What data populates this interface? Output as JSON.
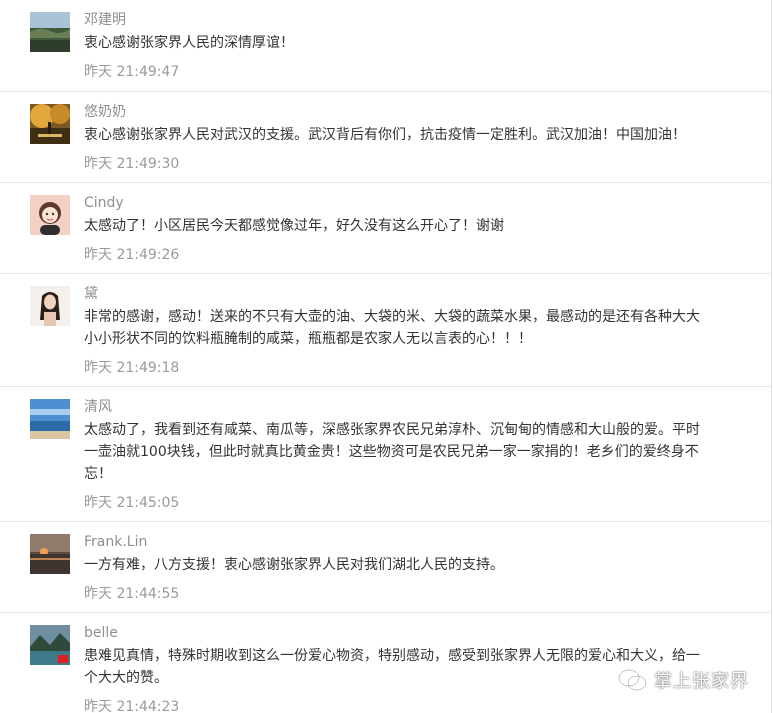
{
  "comments": [
    {
      "nickname": "邓建明",
      "avatar": "landscape-avatar",
      "content": "衷心感谢张家界人民的深情厚谊！",
      "time": "昨天 21:49:47"
    },
    {
      "nickname": "悠奶奶",
      "avatar": "autumn-trees-avatar",
      "content": "衷心感谢张家界人民对武汉的支援。武汉背后有你们，抗击疫情一定胜利。武汉加油！中国加油！",
      "time": "昨天 21:49:30"
    },
    {
      "nickname": "Cindy",
      "avatar": "cartoon-girl-avatar",
      "content": "太感动了！小区居民今天都感觉像过年，好久没有这么开心了！谢谢",
      "time": "昨天 21:49:26"
    },
    {
      "nickname": "黛",
      "avatar": "woman-portrait-avatar",
      "content": "非常的感谢，感动！送来的不只有大壶的油、大袋的米、大袋的蔬菜水果，最感动的是还有各种大大小小形状不同的饮料瓶腌制的咸菜，瓶瓶都是农家人无以言表的心！！！",
      "time": "昨天 21:49:18"
    },
    {
      "nickname": "清风",
      "avatar": "seascape-avatar",
      "content": "太感动了，我看到还有咸菜、南瓜等，深感张家界农民兄弟淳朴、沉甸甸的情感和大山般的爱。平时一壶油就100块钱，但此时就真比黄金贵！这些物资可是农民兄弟一家一家捐的！老乡们的爱终身不忘！",
      "time": "昨天 21:45:05"
    },
    {
      "nickname": "Frank.Lin",
      "avatar": "sunset-avatar",
      "content": "一方有难，八方支援！衷心感谢张家界人民对我们湖北人民的支持。",
      "time": "昨天 21:44:55"
    },
    {
      "nickname": "belle",
      "avatar": "lake-mountain-avatar",
      "content": "患难见真情，特殊时期收到这么一份爱心物资，特别感动，感受到张家界人无限的爱心和大义，给一个大大的赞。",
      "time": "昨天 21:44:23"
    }
  ],
  "watermark": {
    "text": "掌上张家界",
    "icon": "wechat-icon"
  }
}
